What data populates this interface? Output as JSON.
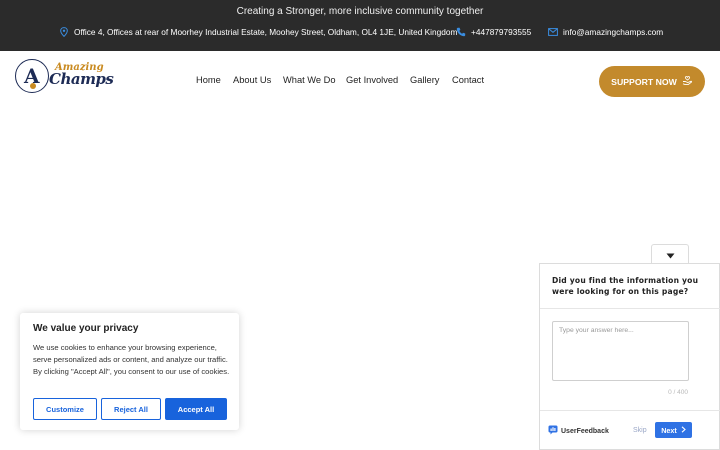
{
  "topbar": {
    "tagline": "Creating a Stronger, more inclusive community together",
    "address": "Office 4, Offices at rear of Moorhey Industrial Estate, Moohey Street, Oldham, OL4 1JE, United Kingdom",
    "phone": "+447879793555",
    "email": "info@amazingchamps.com",
    "background_color": "#2b2b2b",
    "icon_color": "#3a8de0"
  },
  "header": {
    "logo": {
      "top_word": "Amazing",
      "bottom_word": "Champs"
    },
    "nav": [
      "Home",
      "About Us",
      "What We Do",
      "Get Involved",
      "Gallery",
      "Contact"
    ],
    "support_button": {
      "label": "SUPPORT NOW",
      "color": "#c38a2c"
    }
  },
  "cookie_banner": {
    "title": "We value your privacy",
    "text": "We use cookies to enhance your browsing experience, serve personalized ads or content, and analyze our traffic. By clicking \"Accept All\", you consent to our use of cookies.",
    "buttons": {
      "customize": "Customize",
      "reject": "Reject All",
      "accept": "Accept All"
    },
    "accent_color": "#1863dc"
  },
  "feedback_widget": {
    "question": "Did you find the information you were looking for on this page?",
    "placeholder": "Type your answer here...",
    "char_count": "0 / 400",
    "brand": "UserFeedback",
    "skip_label": "Skip",
    "next_label": "Next",
    "accent_color": "#2f72e4"
  }
}
